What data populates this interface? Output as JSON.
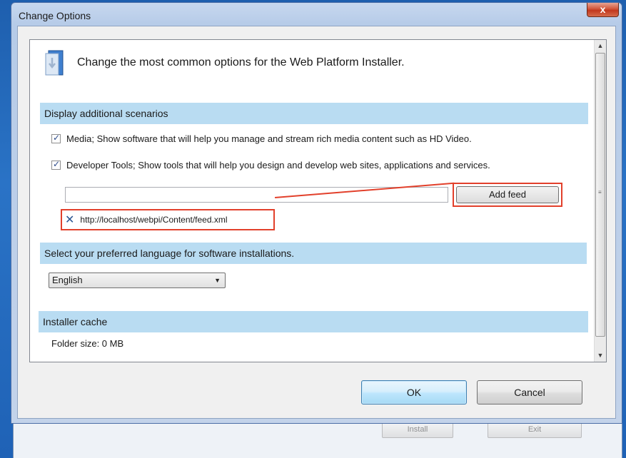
{
  "window": {
    "title": "Change Options",
    "close_label": "x"
  },
  "header": {
    "text": "Change the most common options for the Web Platform Installer."
  },
  "scenarios": {
    "title": "Display additional scenarios",
    "items": [
      {
        "label": "Media; Show software that will help you manage and stream rich media content such as HD Video.",
        "checked": true
      },
      {
        "label": "Developer Tools; Show tools that will help you design and develop web sites, applications and services.",
        "checked": true
      }
    ]
  },
  "feeds": {
    "input_value": "",
    "add_label": "Add feed",
    "items": [
      "http://localhost/webpi/Content/feed.xml"
    ]
  },
  "language": {
    "title": "Select your preferred language for software installations.",
    "selected": "English"
  },
  "cache": {
    "title": "Installer cache",
    "folder_size": "Folder size: 0 MB"
  },
  "buttons": {
    "ok": "OK",
    "cancel": "Cancel"
  },
  "background_window": {
    "button1": "Install",
    "button2": "Exit"
  },
  "colors": {
    "section_bar": "#b9dcf2",
    "highlight": "#e2402b"
  }
}
